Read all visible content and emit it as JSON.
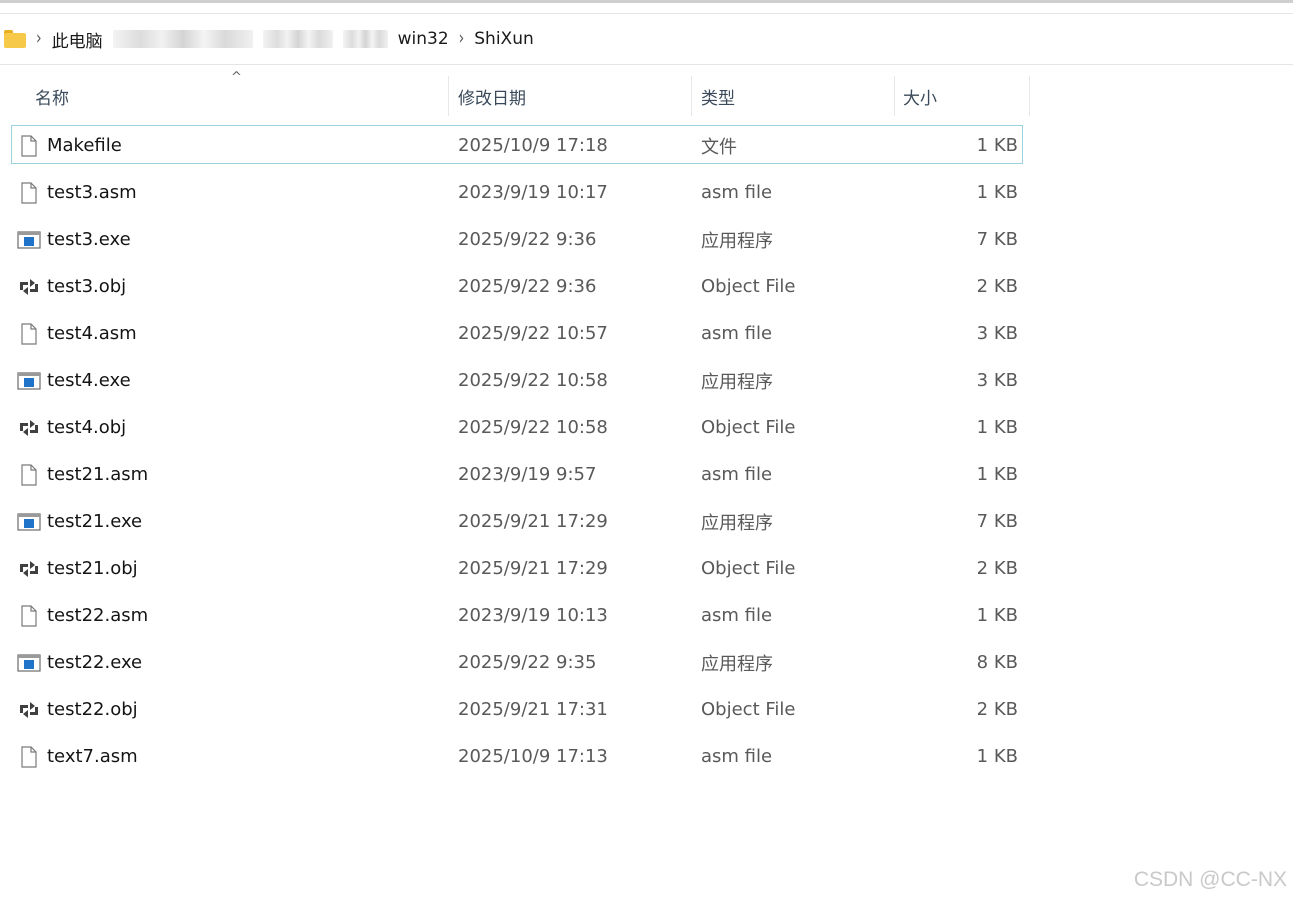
{
  "breadcrumb": {
    "items": [
      "此电脑",
      "win32",
      "ShiXun"
    ]
  },
  "columns": {
    "name": "名称",
    "date": "修改日期",
    "type": "类型",
    "size": "大小"
  },
  "files": [
    {
      "name": "Makefile",
      "date": "2025/10/9 17:18",
      "type": "文件",
      "size": "1 KB",
      "icon": "file-icon",
      "selected": true
    },
    {
      "name": "test3.asm",
      "date": "2023/9/19 10:17",
      "type": "asm file",
      "size": "1 KB",
      "icon": "file-icon"
    },
    {
      "name": "test3.exe",
      "date": "2025/9/22 9:36",
      "type": "应用程序",
      "size": "7 KB",
      "icon": "exe-icon"
    },
    {
      "name": "test3.obj",
      "date": "2025/9/22 9:36",
      "type": "Object File",
      "size": "2 KB",
      "icon": "obj-icon"
    },
    {
      "name": "test4.asm",
      "date": "2025/9/22 10:57",
      "type": "asm file",
      "size": "3 KB",
      "icon": "file-icon"
    },
    {
      "name": "test4.exe",
      "date": "2025/9/22 10:58",
      "type": "应用程序",
      "size": "3 KB",
      "icon": "exe-icon"
    },
    {
      "name": "test4.obj",
      "date": "2025/9/22 10:58",
      "type": "Object File",
      "size": "1 KB",
      "icon": "obj-icon"
    },
    {
      "name": "test21.asm",
      "date": "2023/9/19 9:57",
      "type": "asm file",
      "size": "1 KB",
      "icon": "file-icon"
    },
    {
      "name": "test21.exe",
      "date": "2025/9/21 17:29",
      "type": "应用程序",
      "size": "7 KB",
      "icon": "exe-icon"
    },
    {
      "name": "test21.obj",
      "date": "2025/9/21 17:29",
      "type": "Object File",
      "size": "2 KB",
      "icon": "obj-icon"
    },
    {
      "name": "test22.asm",
      "date": "2023/9/19 10:13",
      "type": "asm file",
      "size": "1 KB",
      "icon": "file-icon"
    },
    {
      "name": "test22.exe",
      "date": "2025/9/22 9:35",
      "type": "应用程序",
      "size": "8 KB",
      "icon": "exe-icon"
    },
    {
      "name": "test22.obj",
      "date": "2025/9/21 17:31",
      "type": "Object File",
      "size": "2 KB",
      "icon": "obj-icon"
    },
    {
      "name": "text7.asm",
      "date": "2025/10/9 17:13",
      "type": "asm file",
      "size": "1 KB",
      "icon": "file-icon"
    }
  ],
  "watermark": "CSDN @CC-NX",
  "colors": {
    "selection_border": "#9ad3df",
    "folder": "#f7c948",
    "exe_blue": "#1f74c9"
  }
}
